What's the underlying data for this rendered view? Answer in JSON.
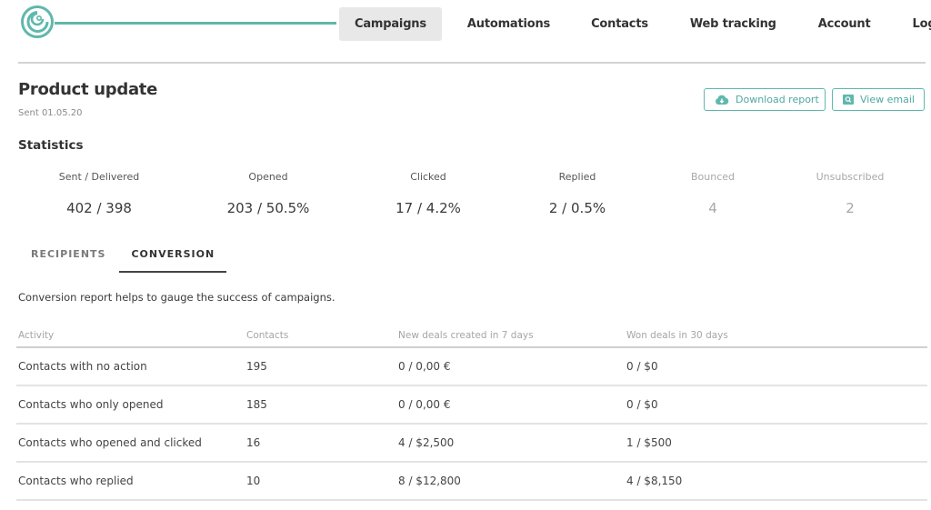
{
  "brand": {
    "accent": "#5fb8ad",
    "logo_icon": "spiral-logo-icon"
  },
  "nav": {
    "items": [
      {
        "label": "Campaigns",
        "active": true
      },
      {
        "label": "Automations",
        "active": false
      },
      {
        "label": "Contacts",
        "active": false
      },
      {
        "label": "Web tracking",
        "active": false
      },
      {
        "label": "Account",
        "active": false
      },
      {
        "label": "Logout",
        "active": false
      }
    ]
  },
  "campaign": {
    "title": "Product update",
    "sent_date": "Sent 01.05.20"
  },
  "actions": {
    "download_report": {
      "label": "Download report",
      "icon": "cloud-download-icon"
    },
    "view_email": {
      "label": "View email",
      "icon": "search-icon"
    }
  },
  "statistics": {
    "title": "Statistics",
    "items": [
      {
        "label": "Sent / Delivered",
        "value": "402 / 398",
        "muted": false
      },
      {
        "label": "Opened",
        "value": "203 / 50.5%",
        "muted": false
      },
      {
        "label": "Clicked",
        "value": "17 / 4.2%",
        "muted": false
      },
      {
        "label": "Replied",
        "value": "2 / 0.5%",
        "muted": false
      },
      {
        "label": "Bounced",
        "value": "4",
        "muted": true
      },
      {
        "label": "Unsubscribed",
        "value": "2",
        "muted": true
      }
    ]
  },
  "tabs": [
    {
      "label": "RECIPIENTS",
      "active": false
    },
    {
      "label": "CONVERSION",
      "active": true
    }
  ],
  "conversion": {
    "description": "Conversion report helps to gauge the success of campaigns.",
    "columns": [
      "Activity",
      "Contacts",
      "New deals created in 7 days",
      "Won deals in 30 days"
    ],
    "rows": [
      [
        "Contacts with no action",
        "195",
        "0 / 0,00 €",
        "0 / $0"
      ],
      [
        "Contacts who only opened",
        "185",
        "0 / 0,00 €",
        "0 / $0"
      ],
      [
        "Contacts who opened and clicked",
        "16",
        "4 / $2,500",
        "1 / $500"
      ],
      [
        "Contacts who replied",
        "10",
        "8 / $12,800",
        "4 / $8,150"
      ]
    ]
  }
}
